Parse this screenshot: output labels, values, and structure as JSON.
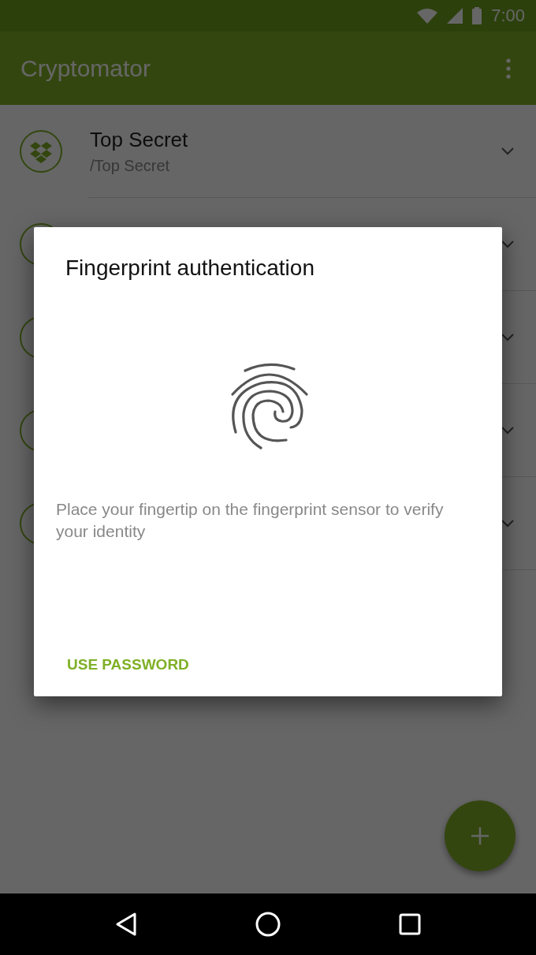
{
  "status_bar": {
    "time": "7:00"
  },
  "app_bar": {
    "title": "Cryptomator"
  },
  "vaults": [
    {
      "kind": "full",
      "name": "Top Secret",
      "path": "/Top Secret"
    },
    {
      "kind": "covered"
    },
    {
      "kind": "covered"
    },
    {
      "kind": "covered"
    },
    {
      "kind": "covered"
    }
  ],
  "dialog": {
    "title": "Fingerprint authentication",
    "message": "Place your fingertip on the fingerprint sensor to verify your identity",
    "button": "USE PASSWORD"
  }
}
